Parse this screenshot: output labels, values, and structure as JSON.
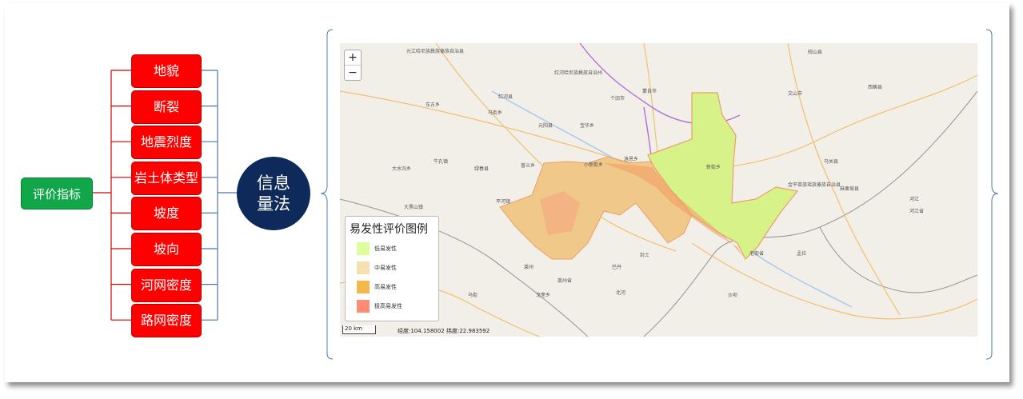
{
  "root": {
    "label": "评价指标"
  },
  "indicators": [
    "地貌",
    "断裂",
    "地震烈度",
    "岩土体类型",
    "坡度",
    "坡向",
    "河网密度",
    "路网密度"
  ],
  "method": {
    "label": "信息量法"
  },
  "colors": {
    "root": "#12a64a",
    "indicator": "#ff0000",
    "method": "#0e2a5a",
    "connector_red": "#d00000",
    "connector_blue": "#4a78a8"
  },
  "map": {
    "zoom_in": "+",
    "zoom_out": "−",
    "legend": {
      "title": "易发性评价图例",
      "items": [
        {
          "label": "低易发性",
          "color": "#ddff99"
        },
        {
          "label": "中易发性",
          "color": "#f7e0b0"
        },
        {
          "label": "高易发性",
          "color": "#f5b84a"
        },
        {
          "label": "极高易发性",
          "color": "#ff8c75"
        }
      ]
    },
    "scale": "20 km",
    "longitude": "经度:104.158002",
    "latitude": "纬度:22.983592",
    "place_labels": [
      "元江哈尼族彝族傣族自治县",
      "红河哈尼族彝族自治州",
      "蒙自市",
      "个旧市",
      "文山市",
      "砚山县",
      "西畴县",
      "马关县",
      "红河县",
      "元阳县",
      "绿春县",
      "金平苗族瑶族傣族自治县",
      "麻栗坡县",
      "河江",
      "河江省",
      "老街省",
      "莱州省",
      "北河",
      "孟拉",
      "莱州",
      "沙坝",
      "巴丹",
      "封土",
      "新街乡",
      "小新街乡",
      "马街乡",
      "大黑山镇",
      "平河镇",
      "牛孔镇",
      "车古乡",
      "普义乡",
      "大水沟乡",
      "戈奎乡",
      "马街",
      "宝华乡",
      "洛恩乡"
    ]
  }
}
